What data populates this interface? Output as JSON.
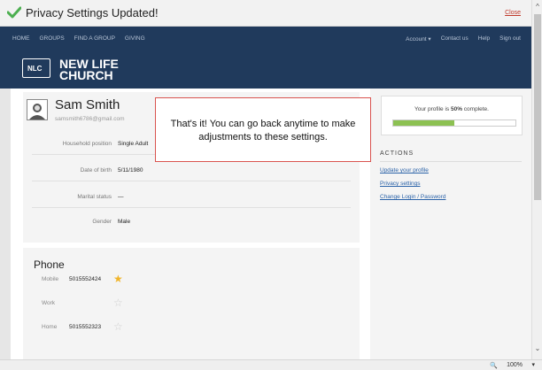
{
  "notification": {
    "message": "Privacy Settings Updated!",
    "close_label": "Close"
  },
  "nav": {
    "left": [
      "HOME",
      "GROUPS",
      "FIND A GROUP",
      "GIVING"
    ],
    "right": [
      "Account ▾",
      "Contact us",
      "Help",
      "Sign out"
    ]
  },
  "brand": {
    "logo_text": "NLC",
    "name_line1": "NEW LIFE",
    "name_line2": "CHURCH"
  },
  "profile": {
    "name": "Sam Smith",
    "email": "samsmith6786@gmail.com",
    "fields": [
      {
        "label": "Household position",
        "value": "Single Adult"
      },
      {
        "label": "Date of birth",
        "value": "5/11/1980"
      },
      {
        "label": "Marital status",
        "value": "—"
      },
      {
        "label": "Gender",
        "value": "Male"
      }
    ]
  },
  "phone": {
    "title": "Phone",
    "rows": [
      {
        "label": "Mobile",
        "number": "5015552424",
        "preferred": true
      },
      {
        "label": "Work",
        "number": "",
        "preferred": false
      },
      {
        "label": "Home",
        "number": "5015552323",
        "preferred": false
      }
    ]
  },
  "sidebar": {
    "progress_prefix": "Your profile is ",
    "progress_value": "50%",
    "progress_suffix": " complete.",
    "progress_fraction": 0.5,
    "actions_title": "ACTIONS",
    "links": [
      "Update your profile",
      "Privacy settings",
      "Change Login / Password"
    ]
  },
  "tooltip": {
    "line1": "That's it!  You can go back anytime to make",
    "line2": "adjustments to these settings."
  },
  "status": {
    "zoom": "100%"
  },
  "colors": {
    "nav_bg": "#203a5c",
    "accent_link": "#2a62a8",
    "progress_fill": "#8cc152",
    "close_red": "#c0392b",
    "star_on": "#f0b429"
  }
}
